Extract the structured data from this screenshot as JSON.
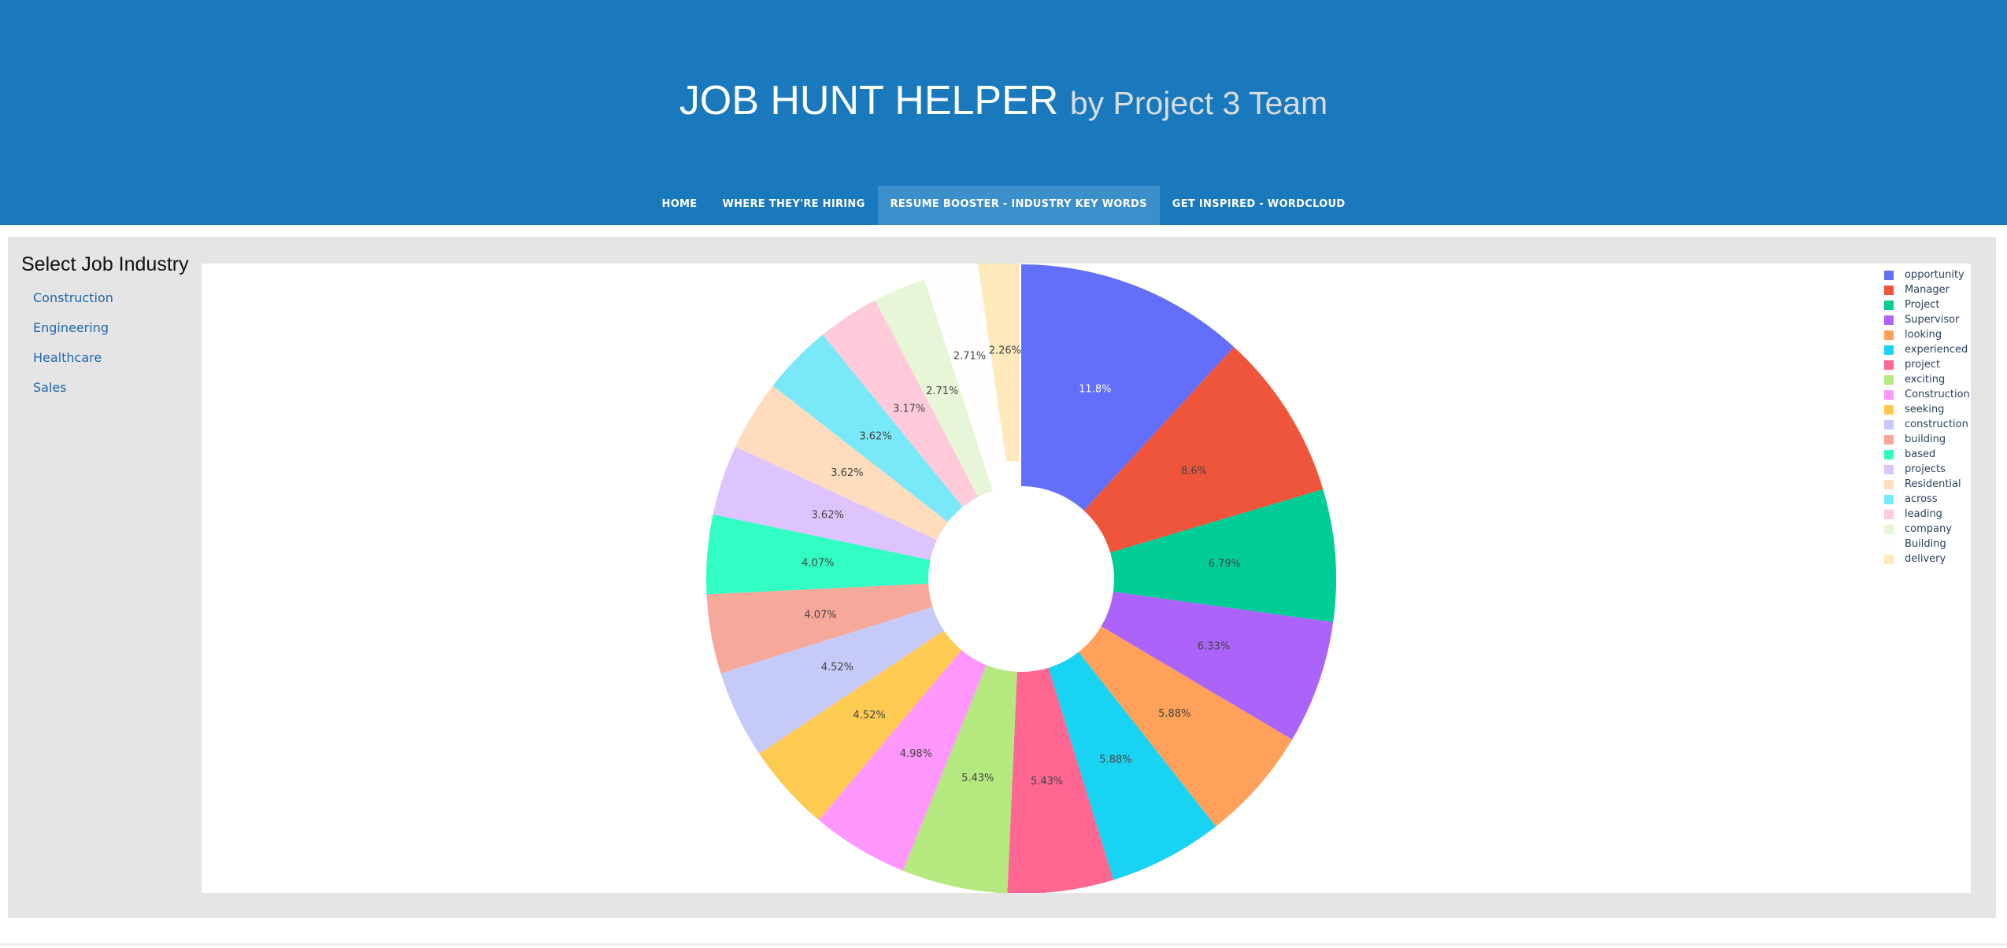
{
  "header": {
    "title": "JOB HUNT HELPER",
    "subtitle": "by Project 3 Team",
    "nav": [
      {
        "label": "HOME",
        "active": false
      },
      {
        "label": "WHERE THEY'RE HIRING",
        "active": false
      },
      {
        "label": "RESUME BOOSTER - INDUSTRY KEY WORDS",
        "active": true
      },
      {
        "label": "GET INSPIRED - WORDCLOUD",
        "active": false
      }
    ]
  },
  "sidebar": {
    "title": "Select Job Industry",
    "items": [
      "Construction",
      "Engineering",
      "Healthcare",
      "Sales"
    ]
  },
  "chart_data": {
    "type": "pie",
    "hole": true,
    "legend_position": "top-right",
    "slices": [
      {
        "label": "opportunity",
        "percent": 11.8,
        "text": "11.8%",
        "color": "#636efa"
      },
      {
        "label": "Manager",
        "percent": 8.6,
        "text": "8.6%",
        "color": "#ef553b"
      },
      {
        "label": "Project",
        "percent": 6.79,
        "text": "6.79%",
        "color": "#00cc96"
      },
      {
        "label": "Supervisor",
        "percent": 6.33,
        "text": "6.33%",
        "color": "#ab63fa"
      },
      {
        "label": "looking",
        "percent": 5.88,
        "text": "5.88%",
        "color": "#ffa15a"
      },
      {
        "label": "experienced",
        "percent": 5.88,
        "text": "5.88%",
        "color": "#19d3f3"
      },
      {
        "label": "project",
        "percent": 5.43,
        "text": "5.43%",
        "color": "#ff6692"
      },
      {
        "label": "exciting",
        "percent": 5.43,
        "text": "5.43%",
        "color": "#b6e880"
      },
      {
        "label": "Construction",
        "percent": 4.98,
        "text": "4.98%",
        "color": "#ff97ff"
      },
      {
        "label": "seeking",
        "percent": 4.52,
        "text": "4.52%",
        "color": "#fecb52"
      },
      {
        "label": "construction",
        "percent": 4.52,
        "text": "4.52%",
        "color": "#c6caf8"
      },
      {
        "label": "building",
        "percent": 4.07,
        "text": "4.07%",
        "color": "#f6a89a"
      },
      {
        "label": "based",
        "percent": 4.07,
        "text": "4.07%",
        "color": "#31fdc5"
      },
      {
        "label": "projects",
        "percent": 3.62,
        "text": "3.62%",
        "color": "#ddc4fd"
      },
      {
        "label": "Residential",
        "percent": 3.62,
        "text": "3.62%",
        "color": "#ffdcbe"
      },
      {
        "label": "across",
        "percent": 3.62,
        "text": "3.62%",
        "color": "#79e9fa"
      },
      {
        "label": "leading",
        "percent": 3.17,
        "text": "3.17%",
        "color": "#ffcad9"
      },
      {
        "label": "company",
        "percent": 2.71,
        "text": "2.71%",
        "color": "#e6f6d6"
      },
      {
        "label": "Building",
        "percent": 2.71,
        "text": "2.71%",
        "color": "#fffdff"
      },
      {
        "label": "delivery",
        "percent": 2.26,
        "text": "2.26%",
        "color": "#fde9bb"
      }
    ]
  }
}
